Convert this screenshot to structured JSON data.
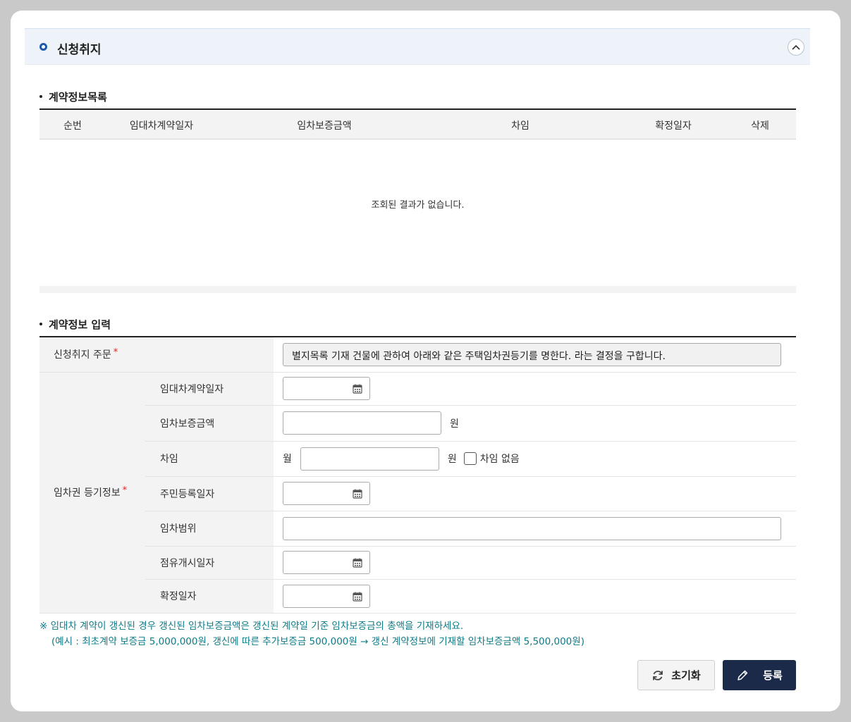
{
  "section": {
    "title": "신청취지",
    "collapse_icon": "chevron-up-icon"
  },
  "contract_list": {
    "title": "계약정보목록",
    "columns": [
      "순번",
      "임대차계약일자",
      "임차보증금액",
      "차임",
      "확정일자",
      "삭제"
    ],
    "rows": [],
    "empty_message": "조회된 결과가 없습니다."
  },
  "contract_input": {
    "title": "계약정보 입력",
    "order_label": "신청취지 주문",
    "order_value": "별지목록 기재 건물에 관하여 아래와 같은 주택임차권등기를 명한다. 라는 결정을 구합니다.",
    "registration_label": "임차권 등기정보",
    "required_mark": "*",
    "fields": {
      "lease_date": {
        "label": "임대차계약일자",
        "value": ""
      },
      "deposit": {
        "label": "임차보증금액",
        "value": "",
        "unit": "원"
      },
      "rent": {
        "label": "차임",
        "prefix": "월",
        "value": "",
        "unit": "원",
        "no_rent_label": "차임 없음",
        "no_rent_checked": false
      },
      "resident_reg_date": {
        "label": "주민등록일자",
        "value": ""
      },
      "lease_scope": {
        "label": "임차범위",
        "value": ""
      },
      "occupancy_start_date": {
        "label": "점유개시일자",
        "value": ""
      },
      "fixed_date": {
        "label": "확정일자",
        "value": ""
      }
    }
  },
  "notice": {
    "line1": "※ 임대차 계약이 갱신된 경우 갱신된 임차보증금액은 갱신된 계약일 기준 임차보증금의 총액을 기재하세요.",
    "line2": "(예시 : 최초계약 보증금 5,000,000원, 갱신에 따른 추가보증금 500,000원 → 갱신 계약정보에 기재할 임차보증금액 5,500,000원)"
  },
  "buttons": {
    "reset": "초기화",
    "register": "등록"
  },
  "colors": {
    "accent": "#1e5aa8",
    "primary_button": "#1c2a4a",
    "notice": "#0e7a86",
    "required": "#dd2222"
  }
}
